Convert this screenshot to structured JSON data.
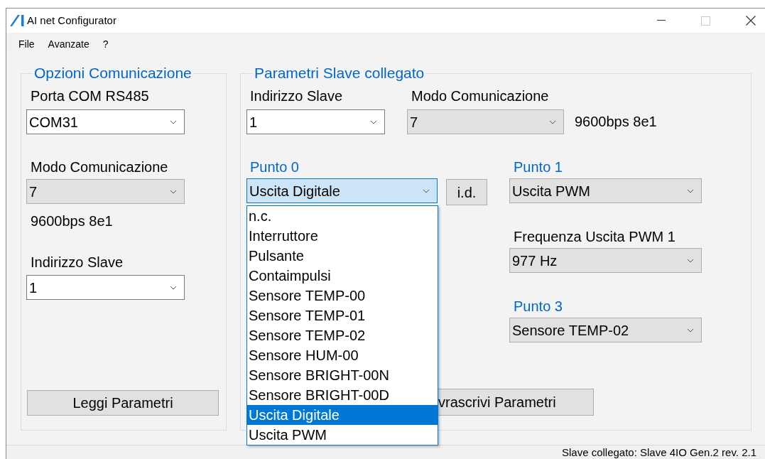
{
  "window": {
    "title": "AI net Configurator"
  },
  "menu": [
    "File",
    "Avanzate",
    "?"
  ],
  "comm_options": {
    "title": "Opzioni Comunicazione",
    "port": {
      "label": "Porta COM RS485",
      "value": "COM31",
      "kind": "editable"
    },
    "mode": {
      "label": "Modo Comunicazione",
      "value": "7",
      "kind": "dropdown"
    },
    "mode_info": "9600bps 8e1",
    "slave_address": {
      "label": "Indirizzo Slave",
      "value": "1",
      "kind": "editable"
    },
    "read_button": "Leggi Parametri"
  },
  "slave_params": {
    "title": "Parametri Slave collegato",
    "slave_address": {
      "label": "Indirizzo Slave",
      "value": "1",
      "kind": "editable"
    },
    "mode": {
      "label": "Modo Comunicazione",
      "value": "7",
      "kind": "dropdown"
    },
    "mode_info": "9600bps 8e1",
    "point_0": {
      "label": "Punto 0",
      "accent": true,
      "value": "Uscita Digitale",
      "open": true,
      "options": [
        {
          "label": "n.c.",
          "selected": false
        },
        {
          "label": "Interruttore",
          "selected": false
        },
        {
          "label": "Pulsante",
          "selected": false
        },
        {
          "label": "Contaimpulsi",
          "selected": false
        },
        {
          "label": "Sensore TEMP-00",
          "selected": false
        },
        {
          "label": "Sensore TEMP-01",
          "selected": false
        },
        {
          "label": "Sensore TEMP-02",
          "selected": false
        },
        {
          "label": "Sensore HUM-00",
          "selected": false
        },
        {
          "label": "Sensore BRIGHT-00N",
          "selected": false
        },
        {
          "label": "Sensore BRIGHT-00D",
          "selected": false
        },
        {
          "label": "Uscita Digitale",
          "selected": true
        },
        {
          "label": "Uscita PWM",
          "selected": false
        }
      ]
    },
    "id_button": "i.d.",
    "point_1": {
      "label": "Punto 1",
      "accent": true,
      "value": "Uscita PWM",
      "kind": "dropdown",
      "open": false
    },
    "pwm_frequency_1": {
      "label": "Frequenza Uscita PWM 1",
      "accent": false,
      "value": "977 Hz",
      "kind": "dropdown",
      "open": false
    },
    "point_3": {
      "label": "Punto 3",
      "accent": true,
      "value": "Sensore TEMP-02",
      "kind": "dropdown",
      "open": false
    },
    "write_button": "vrascrivi Parametri"
  },
  "status_bar": "Slave collegato: Slave 4IO Gen.2 rev. 2.1"
}
